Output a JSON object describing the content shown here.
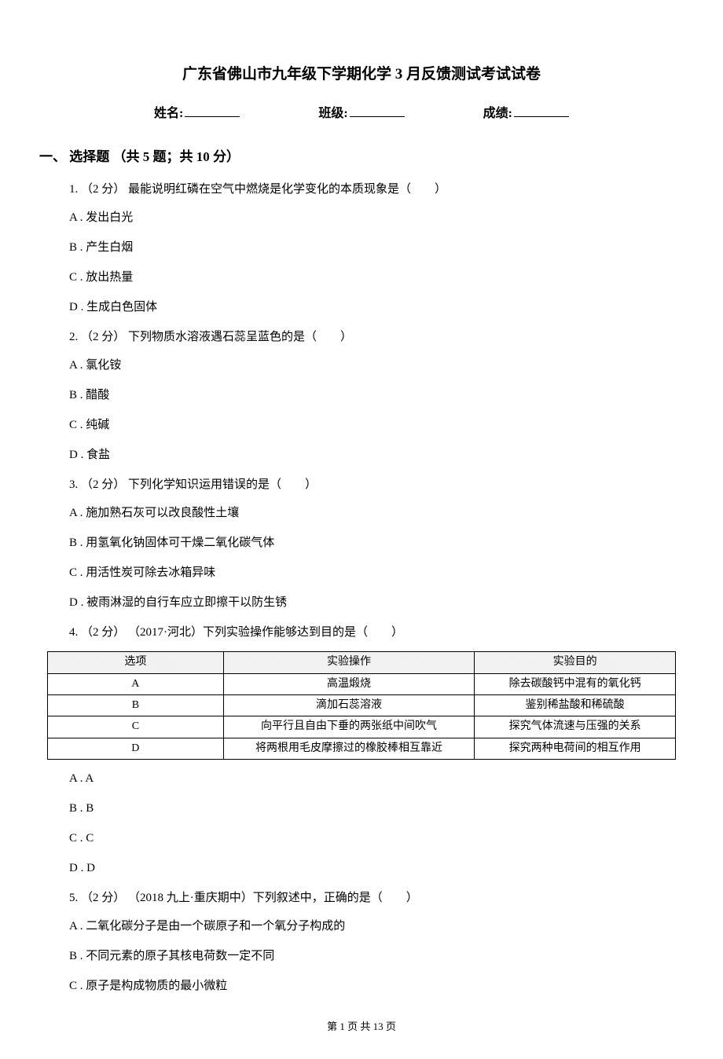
{
  "title": "广东省佛山市九年级下学期化学 3 月反馈测试考试试卷",
  "info": {
    "name_label": "姓名:",
    "class_label": "班级:",
    "score_label": "成绩:"
  },
  "section1": {
    "header": "一、 选择题 （共 5 题；共 10 分）",
    "q1": {
      "stem": "1.  （2 分）  最能说明红磷在空气中燃烧是化学变化的本质现象是（　　）",
      "a": "A .  发出白光",
      "b": "B .  产生白烟",
      "c": "C .  放出热量",
      "d": "D .  生成白色固体"
    },
    "q2": {
      "stem": "2.  （2 分）  下列物质水溶液遇石蕊呈蓝色的是（　　）",
      "a": "A .  氯化铵",
      "b": "B .  醋酸",
      "c": "C .  纯碱",
      "d": "D .  食盐"
    },
    "q3": {
      "stem": "3.  （2 分）  下列化学知识运用错误的是（　　）",
      "a": "A .  施加熟石灰可以改良酸性土壤",
      "b": "B .  用氢氧化钠固体可干燥二氧化碳气体",
      "c": "C .  用活性炭可除去冰箱异味",
      "d": "D .  被雨淋湿的自行车应立即擦干以防生锈"
    },
    "q4": {
      "stem": "4.  （2 分） （2017·河北）下列实验操作能够达到目的是（　　）",
      "table": {
        "headers": [
          "选项",
          "实验操作",
          "实验目的"
        ],
        "rows": [
          [
            "A",
            "高温煅烧",
            "除去碳酸钙中混有的氧化钙"
          ],
          [
            "B",
            "滴加石蕊溶液",
            "鉴别稀盐酸和稀硫酸"
          ],
          [
            "C",
            "向平行且自由下垂的两张纸中间吹气",
            "探究气体流速与压强的关系"
          ],
          [
            "D",
            "将两根用毛皮摩擦过的橡胶棒相互靠近",
            "探究两种电荷间的相互作用"
          ]
        ]
      },
      "a": "A .  A",
      "b": "B .  B",
      "c": "C .  C",
      "d": "D .  D"
    },
    "q5": {
      "stem": "5.  （2 分） （2018 九上·重庆期中）下列叙述中，正确的是（　　）",
      "a": "A .  二氧化碳分子是由一个碳原子和一个氧分子构成的",
      "b": "B .  不同元素的原子其核电荷数一定不同",
      "c": "C .  原子是构成物质的最小微粒"
    }
  },
  "footer": "第 1 页 共 13 页"
}
